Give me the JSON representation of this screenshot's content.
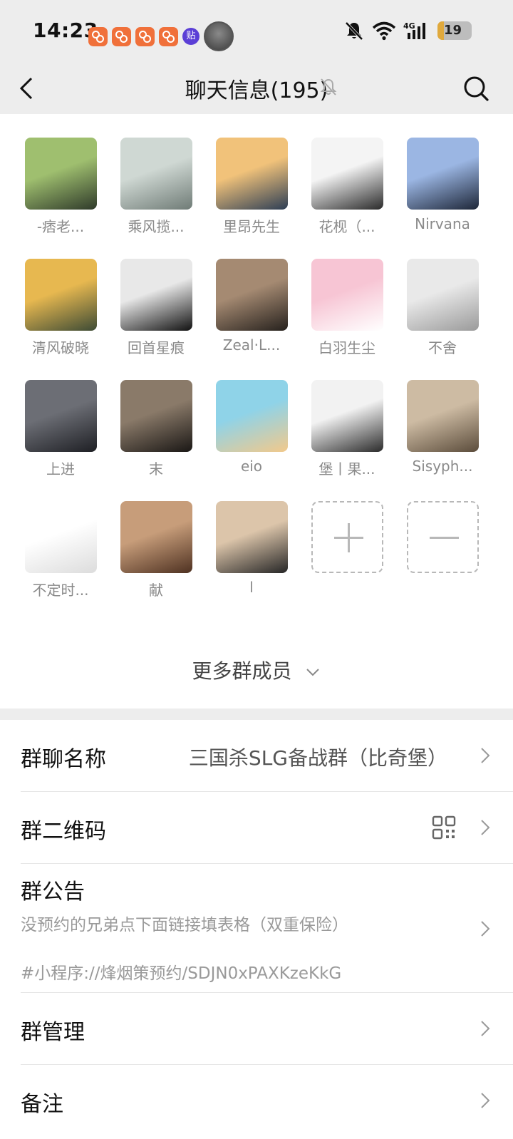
{
  "status_bar": {
    "time": "14:23",
    "notification_badge": "贴",
    "battery_percent": "19"
  },
  "header": {
    "title": "聊天信息(195)"
  },
  "members": [
    {
      "name": "-痞老...",
      "colors": [
        "#9fbf6f",
        "#2f3a2a"
      ]
    },
    {
      "name": "乘风揽...",
      "colors": [
        "#cfd8d3",
        "#6f7b76"
      ]
    },
    {
      "name": "里昂先生",
      "colors": [
        "#f1c27a",
        "#2d3e55"
      ]
    },
    {
      "name": "花枧（...",
      "colors": [
        "#f4f4f4",
        "#2a2a2a"
      ]
    },
    {
      "name": "Nirvana",
      "colors": [
        "#9bb6e3",
        "#1d2638"
      ]
    },
    {
      "name": "清风破晓",
      "colors": [
        "#e7b850",
        "#3d4b35"
      ]
    },
    {
      "name": "回首星痕",
      "colors": [
        "#e8e8e8",
        "#111111"
      ]
    },
    {
      "name": "Zeal·L...",
      "colors": [
        "#a58a72",
        "#26211d"
      ]
    },
    {
      "name": "白羽生尘",
      "colors": [
        "#f7c5d4",
        "#ffffff"
      ]
    },
    {
      "name": "不舍",
      "colors": [
        "#e9e9e9",
        "#9a9a9a"
      ]
    },
    {
      "name": "上进",
      "colors": [
        "#6c6e75",
        "#1e1f24"
      ]
    },
    {
      "name": "末",
      "colors": [
        "#8a7a69",
        "#1a1715"
      ]
    },
    {
      "name": "eio",
      "colors": [
        "#8fd3e8",
        "#f2c98b"
      ]
    },
    {
      "name": "堡丨果...",
      "colors": [
        "#f2f2f2",
        "#2b2b2b"
      ]
    },
    {
      "name": "Sisyph...",
      "colors": [
        "#cdbba3",
        "#5b4c3b"
      ]
    },
    {
      "name": "不定时...",
      "colors": [
        "#ffffff",
        "#dcdcdc"
      ]
    },
    {
      "name": "献",
      "colors": [
        "#c79d7a",
        "#4e3121"
      ]
    },
    {
      "name": "l",
      "colors": [
        "#dcc5aa",
        "#262626"
      ]
    }
  ],
  "member_actions": {
    "add_icon": "plus-icon",
    "remove_icon": "minus-icon"
  },
  "more_members_label": "更多群成员",
  "settings": {
    "group_name_label": "群聊名称",
    "group_name_value": "三国杀SLG备战群（比奇堡）",
    "qr_label": "群二维码",
    "notice_label": "群公告",
    "notice_line1": "没预约的兄弟点下面链接填表格（双重保险）",
    "notice_line2": "#小程序://烽烟策预约/SDJN0xPAXKzeKkG",
    "manage_label": "群管理",
    "remark_label": "备注"
  },
  "colors": {
    "background": "#ededed",
    "panel": "#ffffff",
    "secondary_text": "#8a8a8a",
    "notification_app": "#f0703a",
    "battery": "#e0a93c"
  }
}
